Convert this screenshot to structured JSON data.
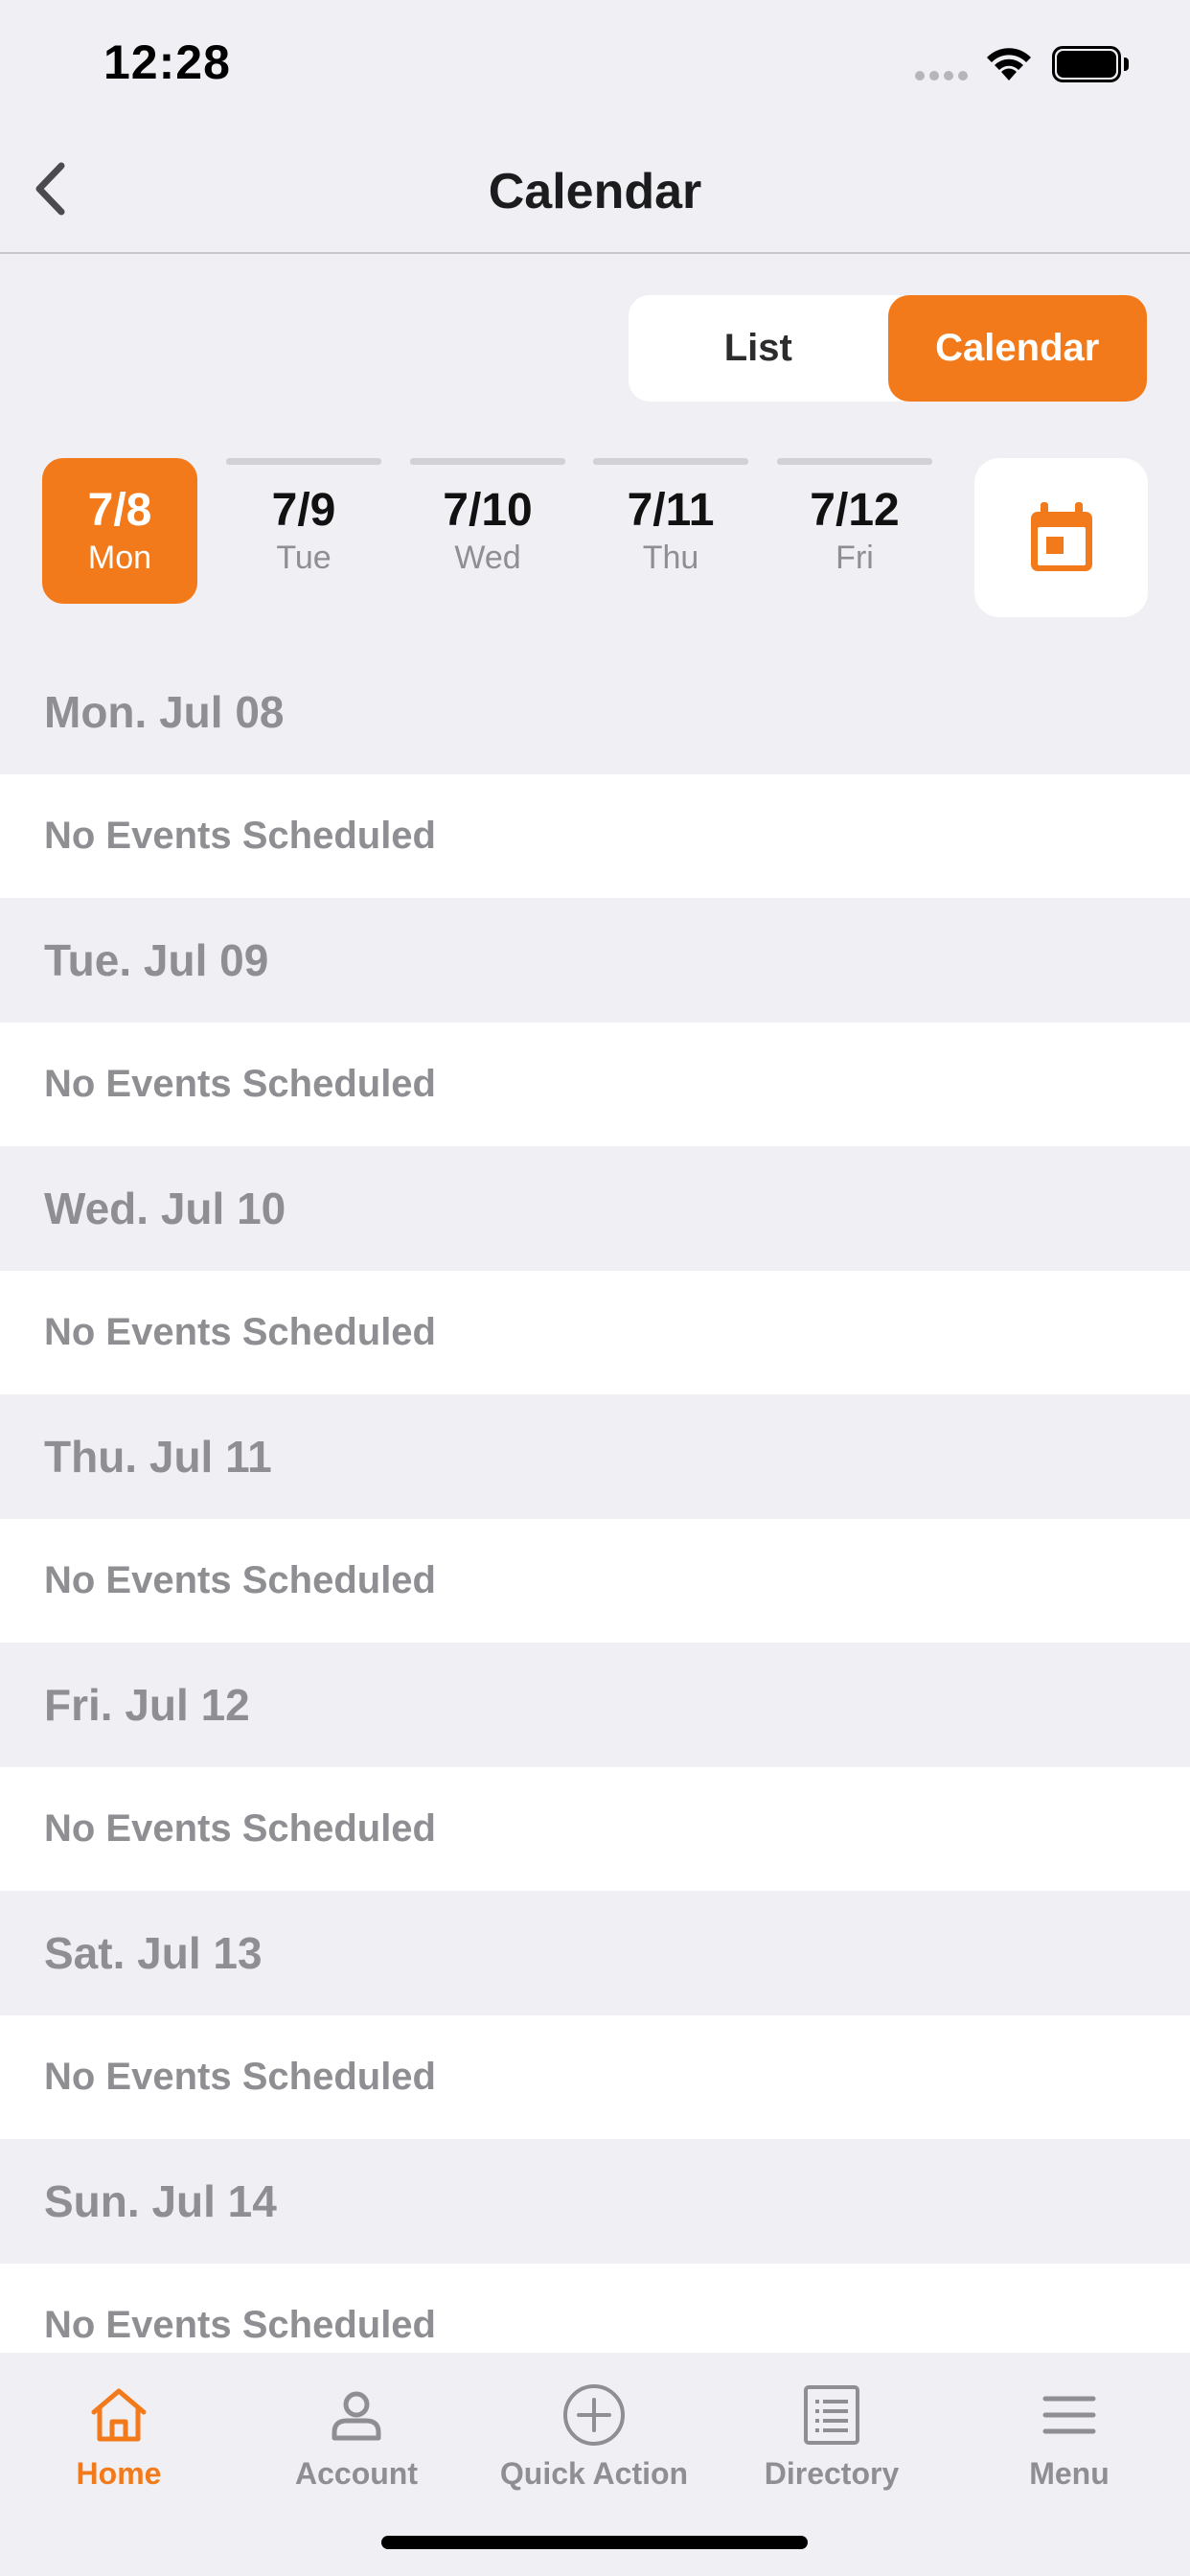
{
  "status_bar": {
    "time": "12:28"
  },
  "nav": {
    "title": "Calendar"
  },
  "view_toggle": {
    "list_label": "List",
    "calendar_label": "Calendar",
    "selected": "Calendar"
  },
  "date_strip": [
    {
      "date": "7/8",
      "weekday": "Mon",
      "selected": true
    },
    {
      "date": "7/9",
      "weekday": "Tue",
      "selected": false
    },
    {
      "date": "7/10",
      "weekday": "Wed",
      "selected": false
    },
    {
      "date": "7/11",
      "weekday": "Thu",
      "selected": false
    },
    {
      "date": "7/12",
      "weekday": "Fri",
      "selected": false
    }
  ],
  "days": [
    {
      "header": "Mon. Jul 08",
      "message": "No Events Scheduled"
    },
    {
      "header": "Tue. Jul 09",
      "message": "No Events Scheduled"
    },
    {
      "header": "Wed. Jul 10",
      "message": "No Events Scheduled"
    },
    {
      "header": "Thu. Jul 11",
      "message": "No Events Scheduled"
    },
    {
      "header": "Fri. Jul 12",
      "message": "No Events Scheduled"
    },
    {
      "header": "Sat. Jul 13",
      "message": "No Events Scheduled"
    },
    {
      "header": "Sun. Jul 14",
      "message": "No Events Scheduled"
    }
  ],
  "tabs": [
    {
      "label": "Home",
      "icon": "home-icon",
      "active": true
    },
    {
      "label": "Account",
      "icon": "person-icon",
      "active": false
    },
    {
      "label": "Quick Action",
      "icon": "plus-circle-icon",
      "active": false
    },
    {
      "label": "Directory",
      "icon": "list-document-icon",
      "active": false
    },
    {
      "label": "Menu",
      "icon": "hamburger-menu-icon",
      "active": false
    }
  ],
  "colors": {
    "accent": "#f27a1a",
    "background": "#efeff4",
    "muted_text": "#8e8e93"
  }
}
